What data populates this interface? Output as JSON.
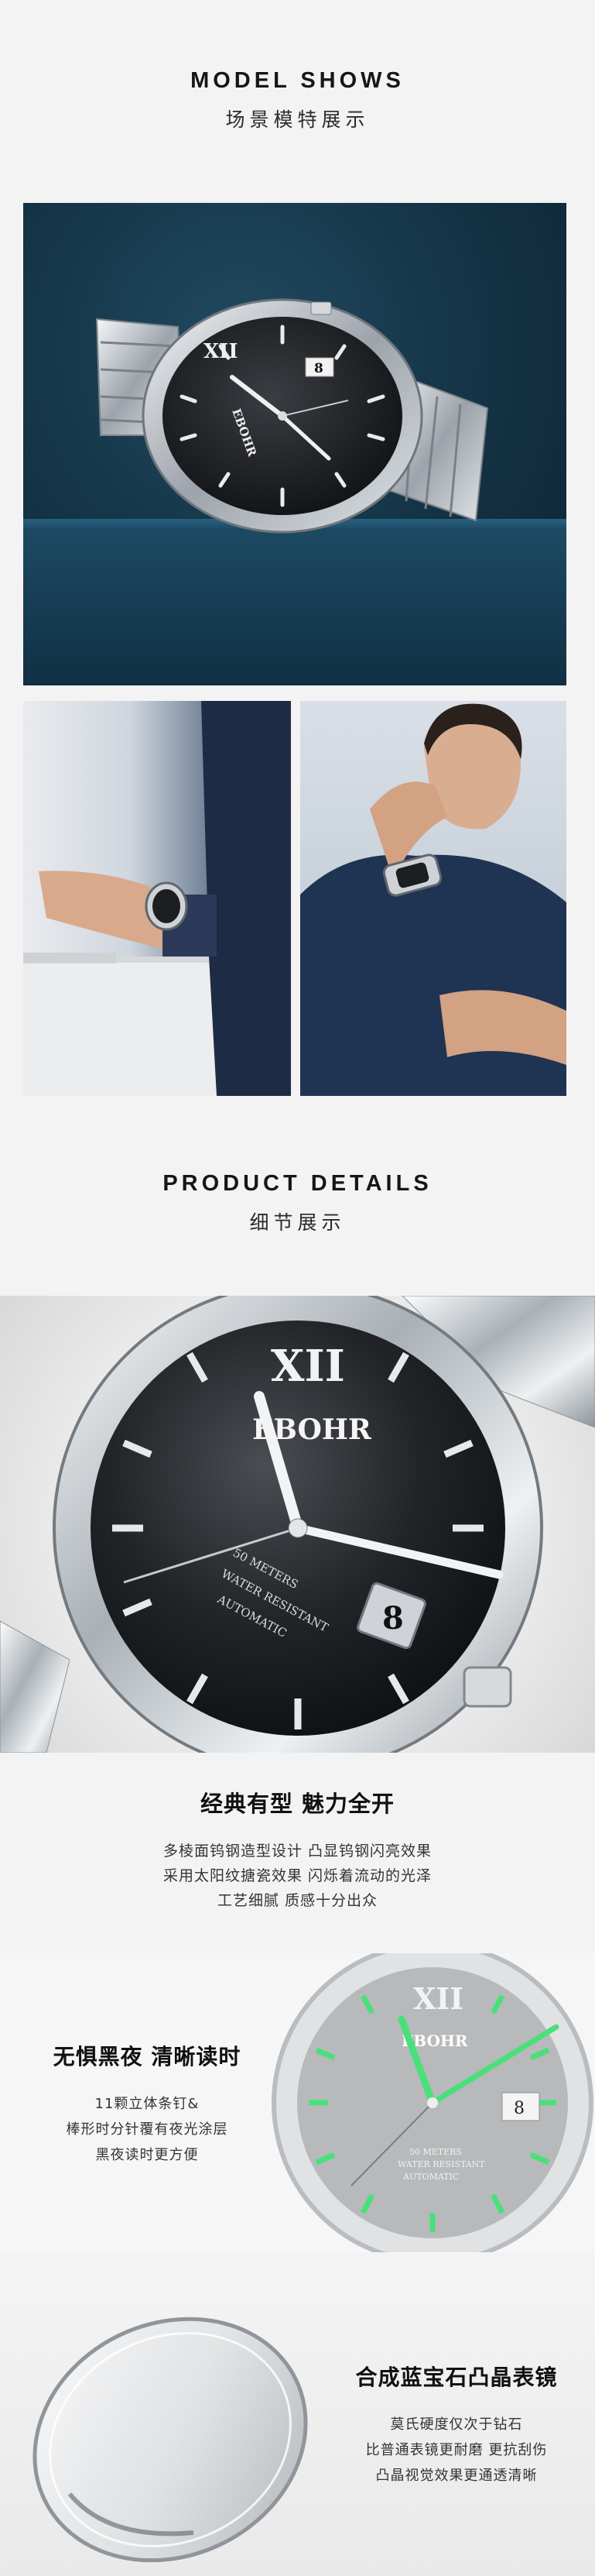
{
  "model_section": {
    "title": "MODEL SHOWS",
    "subtitle": "场景模特展示"
  },
  "details_section": {
    "title": "PRODUCT DETAILS",
    "subtitle": "细节展示"
  },
  "watch": {
    "brand": "EBOHR",
    "dial_text_1": "50 METERS",
    "dial_text_2": "WATER RESISTANT",
    "dial_text_3": "AUTOMATIC",
    "date_value": "8",
    "roman_numeral": "XII"
  },
  "feature_classic": {
    "title": "经典有型 魅力全开",
    "lines": [
      "多棱面钨钢造型设计 凸显钨钢闪亮效果",
      "采用太阳纹搪瓷效果 闪烁着流动的光泽",
      "工艺细腻 质感十分出众"
    ]
  },
  "feature_night": {
    "title": "无惧黑夜 清晰读时",
    "lines": [
      "11颗立体条钉&",
      "棒形时分针覆有夜光涂层",
      "黑夜读时更方便"
    ]
  },
  "feature_sapphire": {
    "title": "合成蓝宝石凸晶表镜",
    "lines": [
      "莫氏硬度仅次于钻石",
      "比普通表镜更耐磨 更抗刮伤",
      "凸晶视觉效果更通透清晰"
    ]
  },
  "colors": {
    "hero_bg": "#163649",
    "lume_green": "#49e07a",
    "dial_black": "#1a1b1d",
    "steel": "#c9cdd1"
  }
}
